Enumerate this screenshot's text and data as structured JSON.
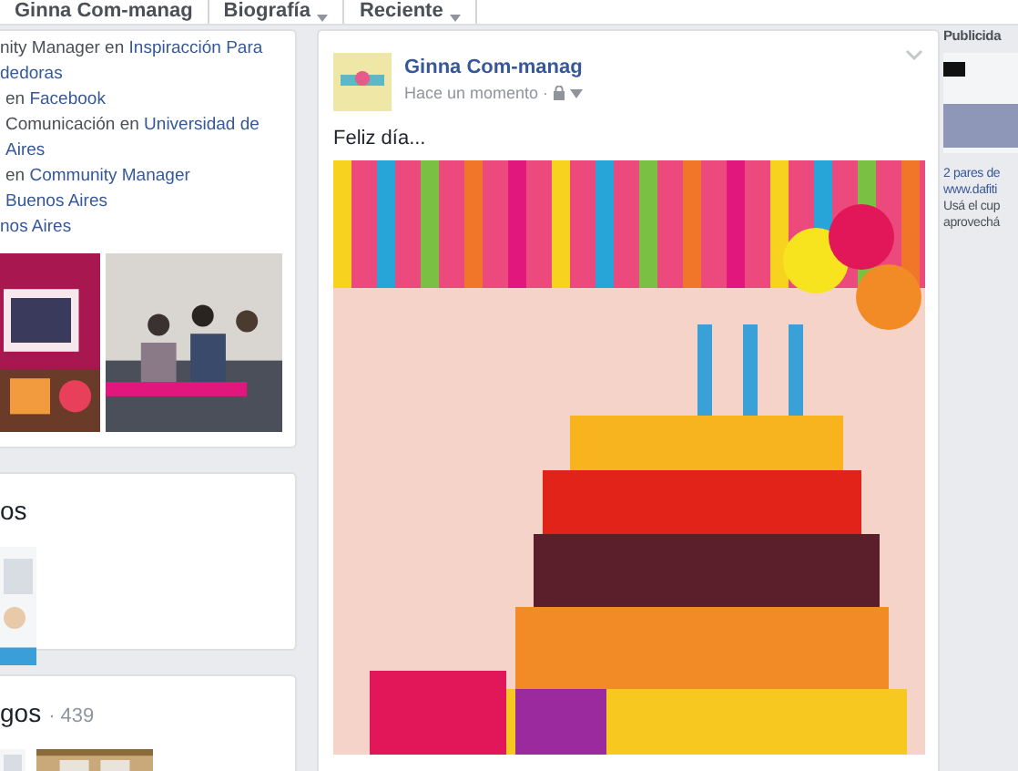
{
  "top_tabs": [
    {
      "label": "Ginna Com-manag",
      "caret": false
    },
    {
      "label": "Biografía",
      "caret": true
    },
    {
      "label": "Reciente",
      "caret": true
    }
  ],
  "intro": [
    {
      "segments": [
        {
          "text": "nity Manager en ",
          "link": false
        },
        {
          "text": "Inspiracción Para",
          "link": true
        }
      ],
      "indent": false
    },
    {
      "segments": [
        {
          "text": "dedoras",
          "link": true
        }
      ],
      "indent": false
    },
    {
      "segments": [
        {
          "text": "en ",
          "link": false
        },
        {
          "text": "Facebook",
          "link": true
        }
      ],
      "indent": true
    },
    {
      "segments": [
        {
          "text": "Comunicación en ",
          "link": false
        },
        {
          "text": "Universidad de",
          "link": true
        }
      ],
      "indent": true
    },
    {
      "segments": [
        {
          "text": "Aires",
          "link": true
        }
      ],
      "indent": true
    },
    {
      "segments": [
        {
          "text": "en ",
          "link": false
        },
        {
          "text": "Community Manager",
          "link": true
        }
      ],
      "indent": true
    },
    {
      "segments": [
        {
          "text": "Buenos Aires",
          "link": true
        }
      ],
      "indent": true
    },
    {
      "segments": [
        {
          "text": "nos Aires",
          "link": true
        }
      ],
      "indent": false
    }
  ],
  "card_2": {
    "title": "os"
  },
  "card_3": {
    "title": "gos",
    "count": "· 439"
  },
  "post": {
    "author": "Ginna Com-manag",
    "time": "Hace un momento ·",
    "text": "Feliz día..."
  },
  "ad": {
    "heading": "Publicida",
    "title": "2 pares de",
    "url": "www.dafiti",
    "lines": [
      "Usá el cup",
      "aprovechá"
    ]
  }
}
